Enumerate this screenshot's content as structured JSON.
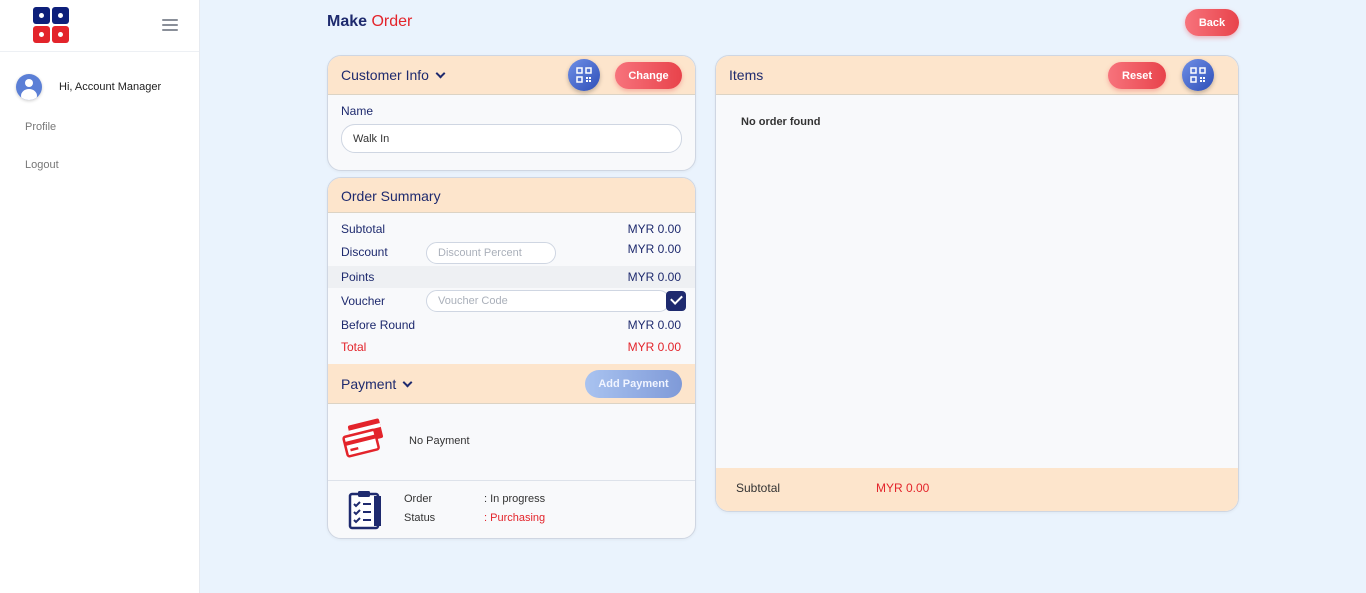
{
  "sidebar": {
    "user_greeting": "Hi, Account Manager",
    "links": [
      "Profile",
      "Logout"
    ]
  },
  "header": {
    "title_main": "Make",
    "title_accent": "Order",
    "back_label": "Back"
  },
  "customer": {
    "title": "Customer Info",
    "change_label": "Change",
    "name_label": "Name",
    "name_value": "Walk In"
  },
  "summary": {
    "title": "Order Summary",
    "subtotal_label": "Subtotal",
    "subtotal_value": "MYR 0.00",
    "discount_label": "Discount",
    "discount_placeholder": "Discount Percent",
    "discount_value": "MYR 0.00",
    "points_label": "Points",
    "points_value": "MYR 0.00",
    "voucher_label": "Voucher",
    "voucher_placeholder": "Voucher Code",
    "before_round_label": "Before Round",
    "before_round_value": "MYR 0.00",
    "total_label": "Total",
    "total_value": "MYR 0.00"
  },
  "payment": {
    "title": "Payment",
    "add_label": "Add Payment",
    "empty_text": "No Payment"
  },
  "order_status": {
    "order_label": "Order",
    "order_value": ": In progress",
    "status_label": "Status",
    "status_value": ": Purchasing"
  },
  "items": {
    "title": "Items",
    "reset_label": "Reset",
    "empty_text": "No order found",
    "subtotal_label": "Subtotal",
    "subtotal_value": "MYR 0.00"
  },
  "colors": {
    "primary_navy": "#1e2a6e",
    "accent_red": "#e3242b",
    "header_peach": "#fde5cc",
    "background": "#eaf3fd"
  },
  "icons": [
    "hamburger-icon",
    "user-avatar-icon",
    "chevron-down-icon",
    "qr-code-icon",
    "check-icon",
    "credit-card-icon",
    "clipboard-checklist-icon"
  ]
}
